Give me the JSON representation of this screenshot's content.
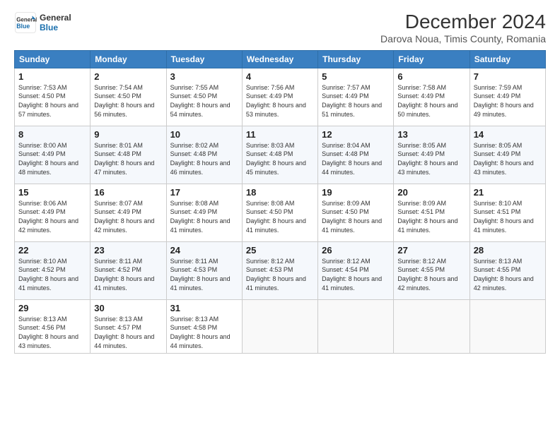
{
  "logo": {
    "line1": "General",
    "line2": "Blue"
  },
  "title": "December 2024",
  "subtitle": "Darova Noua, Timis County, Romania",
  "weekdays": [
    "Sunday",
    "Monday",
    "Tuesday",
    "Wednesday",
    "Thursday",
    "Friday",
    "Saturday"
  ],
  "weeks": [
    [
      {
        "day": "1",
        "sunrise": "7:53 AM",
        "sunset": "4:50 PM",
        "daylight": "8 hours and 57 minutes."
      },
      {
        "day": "2",
        "sunrise": "7:54 AM",
        "sunset": "4:50 PM",
        "daylight": "8 hours and 56 minutes."
      },
      {
        "day": "3",
        "sunrise": "7:55 AM",
        "sunset": "4:50 PM",
        "daylight": "8 hours and 54 minutes."
      },
      {
        "day": "4",
        "sunrise": "7:56 AM",
        "sunset": "4:49 PM",
        "daylight": "8 hours and 53 minutes."
      },
      {
        "day": "5",
        "sunrise": "7:57 AM",
        "sunset": "4:49 PM",
        "daylight": "8 hours and 51 minutes."
      },
      {
        "day": "6",
        "sunrise": "7:58 AM",
        "sunset": "4:49 PM",
        "daylight": "8 hours and 50 minutes."
      },
      {
        "day": "7",
        "sunrise": "7:59 AM",
        "sunset": "4:49 PM",
        "daylight": "8 hours and 49 minutes."
      }
    ],
    [
      {
        "day": "8",
        "sunrise": "8:00 AM",
        "sunset": "4:49 PM",
        "daylight": "8 hours and 48 minutes."
      },
      {
        "day": "9",
        "sunrise": "8:01 AM",
        "sunset": "4:48 PM",
        "daylight": "8 hours and 47 minutes."
      },
      {
        "day": "10",
        "sunrise": "8:02 AM",
        "sunset": "4:48 PM",
        "daylight": "8 hours and 46 minutes."
      },
      {
        "day": "11",
        "sunrise": "8:03 AM",
        "sunset": "4:48 PM",
        "daylight": "8 hours and 45 minutes."
      },
      {
        "day": "12",
        "sunrise": "8:04 AM",
        "sunset": "4:48 PM",
        "daylight": "8 hours and 44 minutes."
      },
      {
        "day": "13",
        "sunrise": "8:05 AM",
        "sunset": "4:49 PM",
        "daylight": "8 hours and 43 minutes."
      },
      {
        "day": "14",
        "sunrise": "8:05 AM",
        "sunset": "4:49 PM",
        "daylight": "8 hours and 43 minutes."
      }
    ],
    [
      {
        "day": "15",
        "sunrise": "8:06 AM",
        "sunset": "4:49 PM",
        "daylight": "8 hours and 42 minutes."
      },
      {
        "day": "16",
        "sunrise": "8:07 AM",
        "sunset": "4:49 PM",
        "daylight": "8 hours and 42 minutes."
      },
      {
        "day": "17",
        "sunrise": "8:08 AM",
        "sunset": "4:49 PM",
        "daylight": "8 hours and 41 minutes."
      },
      {
        "day": "18",
        "sunrise": "8:08 AM",
        "sunset": "4:50 PM",
        "daylight": "8 hours and 41 minutes."
      },
      {
        "day": "19",
        "sunrise": "8:09 AM",
        "sunset": "4:50 PM",
        "daylight": "8 hours and 41 minutes."
      },
      {
        "day": "20",
        "sunrise": "8:09 AM",
        "sunset": "4:51 PM",
        "daylight": "8 hours and 41 minutes."
      },
      {
        "day": "21",
        "sunrise": "8:10 AM",
        "sunset": "4:51 PM",
        "daylight": "8 hours and 41 minutes."
      }
    ],
    [
      {
        "day": "22",
        "sunrise": "8:10 AM",
        "sunset": "4:52 PM",
        "daylight": "8 hours and 41 minutes."
      },
      {
        "day": "23",
        "sunrise": "8:11 AM",
        "sunset": "4:52 PM",
        "daylight": "8 hours and 41 minutes."
      },
      {
        "day": "24",
        "sunrise": "8:11 AM",
        "sunset": "4:53 PM",
        "daylight": "8 hours and 41 minutes."
      },
      {
        "day": "25",
        "sunrise": "8:12 AM",
        "sunset": "4:53 PM",
        "daylight": "8 hours and 41 minutes."
      },
      {
        "day": "26",
        "sunrise": "8:12 AM",
        "sunset": "4:54 PM",
        "daylight": "8 hours and 41 minutes."
      },
      {
        "day": "27",
        "sunrise": "8:12 AM",
        "sunset": "4:55 PM",
        "daylight": "8 hours and 42 minutes."
      },
      {
        "day": "28",
        "sunrise": "8:13 AM",
        "sunset": "4:55 PM",
        "daylight": "8 hours and 42 minutes."
      }
    ],
    [
      {
        "day": "29",
        "sunrise": "8:13 AM",
        "sunset": "4:56 PM",
        "daylight": "8 hours and 43 minutes."
      },
      {
        "day": "30",
        "sunrise": "8:13 AM",
        "sunset": "4:57 PM",
        "daylight": "8 hours and 44 minutes."
      },
      {
        "day": "31",
        "sunrise": "8:13 AM",
        "sunset": "4:58 PM",
        "daylight": "8 hours and 44 minutes."
      },
      null,
      null,
      null,
      null
    ]
  ],
  "labels": {
    "sunrise": "Sunrise:",
    "sunset": "Sunset:",
    "daylight": "Daylight hours"
  }
}
